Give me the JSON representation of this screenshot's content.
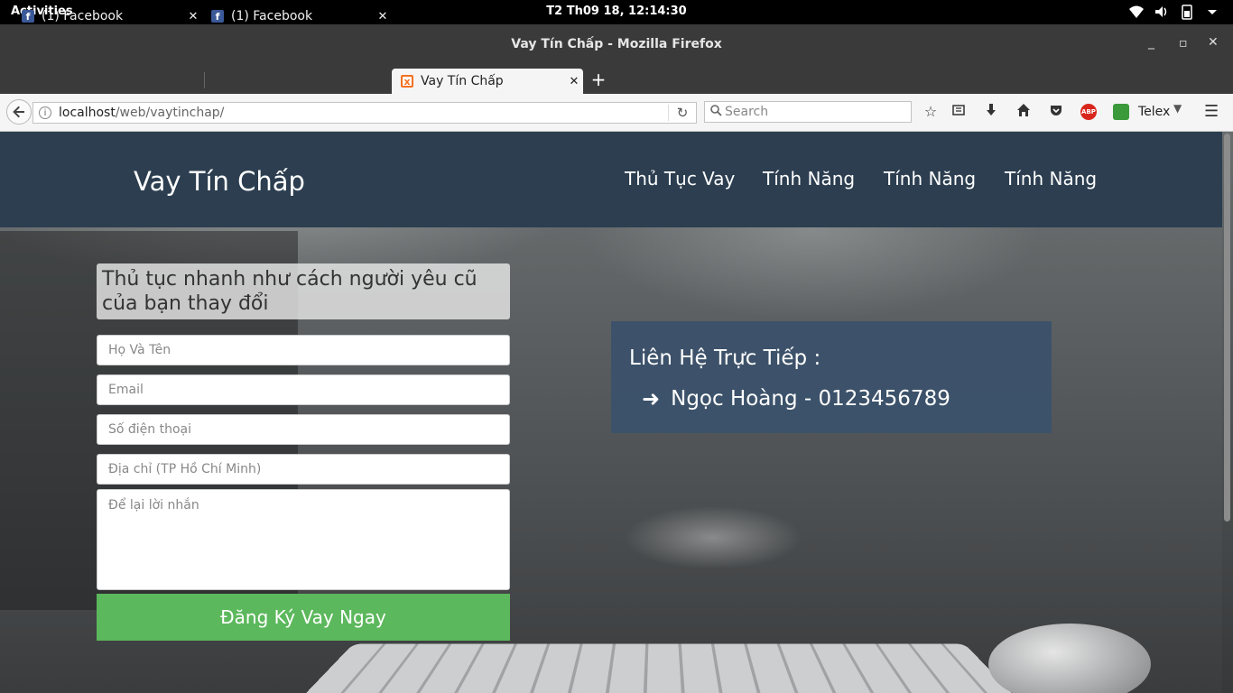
{
  "system": {
    "activities": "Activities",
    "clock": "T2 Th09 18, 12:14:30"
  },
  "window": {
    "title": "Vay Tín Chấp - Mozilla Firefox"
  },
  "tabs": [
    {
      "label": "(1) Facebook"
    },
    {
      "label": "(1) Facebook"
    },
    {
      "label": "Vay Tín Chấp"
    }
  ],
  "toolbar": {
    "url_host": "localhost",
    "url_path": "/web/vaytinchap/",
    "search_placeholder": "Search",
    "telex_label": "Telex"
  },
  "site": {
    "brand": "Vay Tín Chấp",
    "nav": [
      "Thủ Tục Vay",
      "Tính Năng",
      "Tính Năng",
      "Tính Năng"
    ]
  },
  "form": {
    "title": "Thủ tục nhanh như cách người yêu cũ của bạn thay đổi",
    "name_placeholder": "Họ Và Tên",
    "email_placeholder": "Email",
    "phone_placeholder": "Số điện thoại",
    "address_placeholder": "Địa chỉ (TP Hồ Chí Minh)",
    "message_placeholder": "Để lại lời nhắn",
    "submit_label": "Đăng Ký Vay Ngay"
  },
  "contact": {
    "heading": "Liên Hệ Trực Tiếp :",
    "entry": "Ngọc Hoàng - 0123456789"
  },
  "colors": {
    "header_bg": "#2c3e50",
    "submit_bg": "#5cb85c",
    "contact_bg": "#3b516b"
  }
}
